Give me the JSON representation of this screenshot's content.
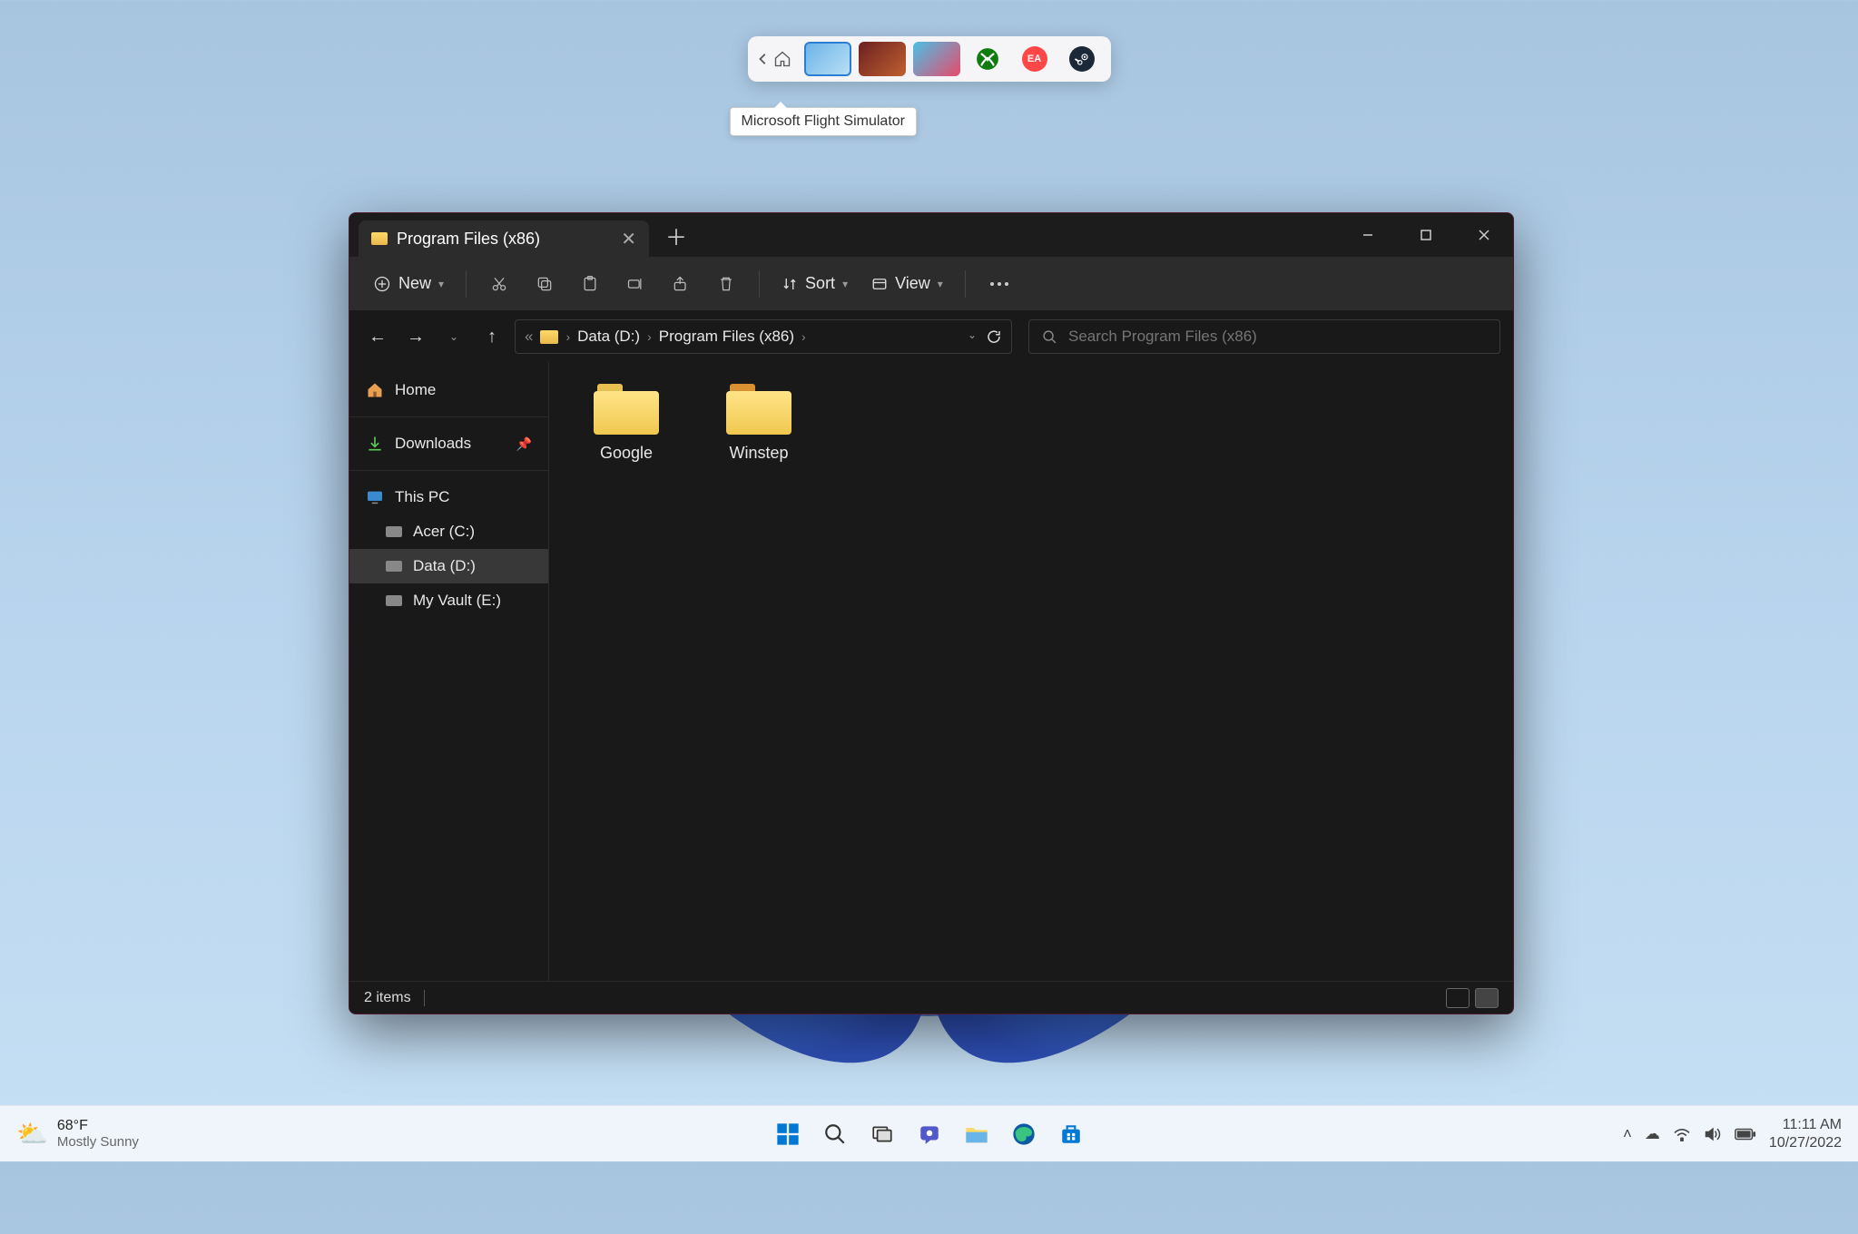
{
  "gamebar": {
    "tooltip": "Microsoft Flight Simulator",
    "services": {
      "xbox": "Xbox",
      "ea": "EA",
      "steam": "Steam"
    }
  },
  "explorer": {
    "tab_title": "Program Files (x86)",
    "toolbar": {
      "new": "New",
      "sort": "Sort",
      "view": "View"
    },
    "breadcrumbs": {
      "drive": "Data (D:)",
      "folder": "Program Files (x86)"
    },
    "search_placeholder": "Search Program Files (x86)",
    "sidebar": {
      "home": "Home",
      "downloads": "Downloads",
      "this_pc": "This PC",
      "drives": [
        {
          "label": "Acer (C:)"
        },
        {
          "label": "Data (D:)"
        },
        {
          "label": "My Vault (E:)"
        }
      ]
    },
    "folders": [
      {
        "name": "Google"
      },
      {
        "name": "Winstep"
      }
    ],
    "status": "2 items"
  },
  "taskbar": {
    "weather": {
      "temp": "68°F",
      "desc": "Mostly Sunny"
    },
    "clock": {
      "time": "11:11 AM",
      "date": "10/27/2022"
    }
  }
}
